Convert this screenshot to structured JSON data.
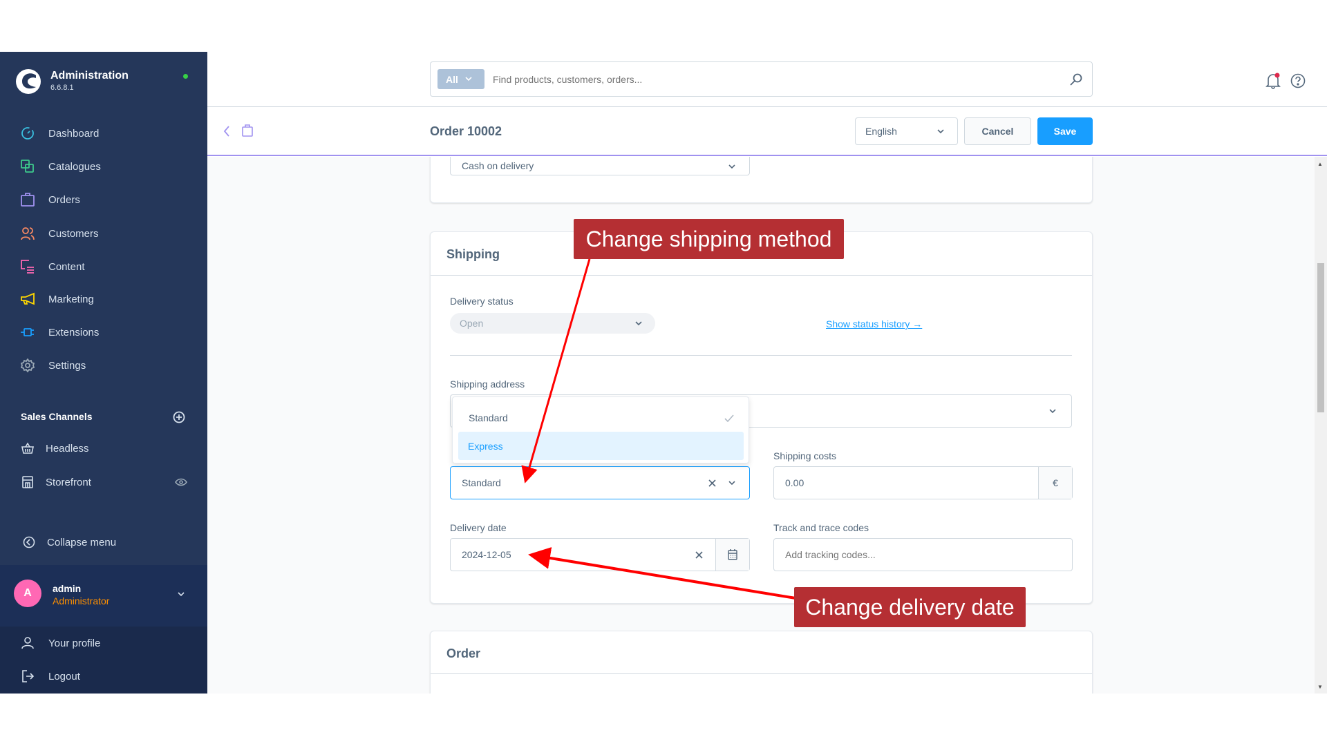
{
  "sidebar": {
    "app_title": "Administration",
    "version": "6.6.8.1",
    "items": [
      {
        "label": "Dashboard",
        "icon": "dashboard-icon",
        "color": "#3ac0e0"
      },
      {
        "label": "Catalogues",
        "icon": "catalogue-icon",
        "color": "#3ecb8c"
      },
      {
        "label": "Orders",
        "icon": "orders-bag-icon",
        "color": "#a092f0"
      },
      {
        "label": "Customers",
        "icon": "customers-icon",
        "color": "#f88962"
      },
      {
        "label": "Content",
        "icon": "content-icon",
        "color": "#ff68b4"
      },
      {
        "label": "Marketing",
        "icon": "megaphone-icon",
        "color": "#ffd700"
      },
      {
        "label": "Extensions",
        "icon": "plug-icon",
        "color": "#189eff"
      },
      {
        "label": "Settings",
        "icon": "gear-icon",
        "color": "#9aa8b5"
      }
    ],
    "sales_channels_title": "Sales Channels",
    "sales_channels": [
      {
        "label": "Headless",
        "icon": "basket-icon"
      },
      {
        "label": "Storefront",
        "icon": "storefront-icon"
      }
    ],
    "collapse_label": "Collapse menu",
    "user": {
      "initial": "A",
      "name": "admin",
      "role": "Administrator"
    },
    "user_menu": [
      {
        "label": "Your profile"
      },
      {
        "label": "Logout"
      }
    ]
  },
  "header": {
    "search_scope": "All",
    "search_placeholder": "Find products, customers, orders..."
  },
  "toolbar": {
    "title": "Order 10002",
    "language": "English",
    "cancel_label": "Cancel",
    "save_label": "Save"
  },
  "payment": {
    "method_value": "Cash on delivery"
  },
  "shipping": {
    "title": "Shipping",
    "delivery_status_label": "Delivery status",
    "delivery_status_value": "Open",
    "status_history_link": "Show status history →",
    "shipping_address_label": "Shipping address",
    "dropdown_options": [
      {
        "label": "Standard",
        "selected": true
      },
      {
        "label": "Express",
        "highlighted": true
      }
    ],
    "shipping_method_value": "Standard",
    "shipping_costs_label": "Shipping costs",
    "shipping_costs_value": "0.00",
    "currency_symbol": "€",
    "delivery_date_label": "Delivery date",
    "delivery_date_value": "2024-12-05",
    "tracking_label": "Track and trace codes",
    "tracking_placeholder": "Add tracking codes..."
  },
  "order": {
    "title": "Order"
  },
  "annotations": {
    "shipping_method": "Change shipping method",
    "delivery_date": "Change delivery date"
  }
}
